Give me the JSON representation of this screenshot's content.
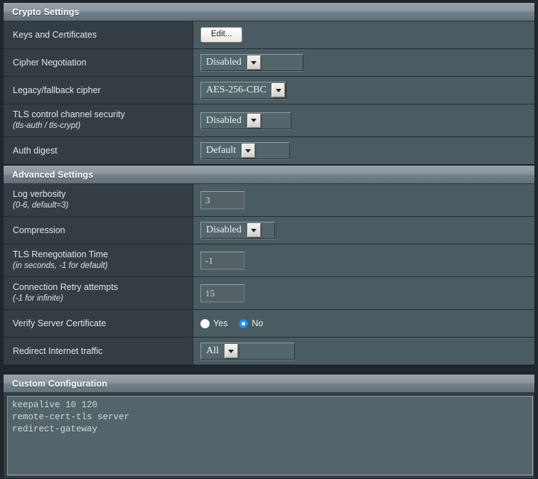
{
  "sections": [
    {
      "id": "crypto",
      "title": "Crypto Settings",
      "rows": [
        {
          "label": "Keys and Certificates",
          "sub": "",
          "control": "button",
          "value": "Edit...",
          "width": 0
        },
        {
          "label": "Cipher Negotiation",
          "sub": "",
          "control": "select",
          "value": "Disabled",
          "width": 145
        },
        {
          "label": "Legacy/fallback cipher",
          "sub": "",
          "control": "select",
          "value": "AES-256-CBC",
          "width": 121
        },
        {
          "label": "TLS control channel security",
          "sub": "(tls-auth / tls-crypt)",
          "control": "select",
          "value": "Disabled",
          "width": 128
        },
        {
          "label": "Auth digest",
          "sub": "",
          "control": "select",
          "value": "Default",
          "width": 126
        }
      ]
    },
    {
      "id": "advanced",
      "title": "Advanced Settings",
      "rows": [
        {
          "label": "Log verbosity",
          "sub": "(0-6, default=3)",
          "control": "text",
          "value": "3",
          "width": 62
        },
        {
          "label": "Compression",
          "sub": "",
          "control": "select",
          "value": "Disabled",
          "width": 105
        },
        {
          "label": "TLS Renegotiation Time",
          "sub": "(in seconds, -1 for default)",
          "control": "text",
          "value": "-1",
          "width": 62
        },
        {
          "label": "Connection Retry attempts",
          "sub": "(-1 for infinite)",
          "control": "text",
          "value": "15",
          "width": 62
        },
        {
          "label": "Verify Server Certificate",
          "sub": "",
          "control": "radio",
          "options": [
            {
              "label": "Yes",
              "selected": false
            },
            {
              "label": "No",
              "selected": true
            }
          ]
        },
        {
          "label": "Redirect Internet traffic",
          "sub": "",
          "control": "select",
          "value": "All",
          "width": 133
        }
      ]
    }
  ],
  "custom_config": {
    "title": "Custom Configuration",
    "text": "keepalive 10 120\nremote-cert-tls server\nredirect-gateway"
  },
  "colors": {
    "page_bg": "#20282d",
    "row_bg": "#343d44",
    "field_bg": "#4a5b61",
    "header_top": "#98a3aa",
    "header_bottom": "#63707a",
    "accent_radio": "#1e90ff",
    "text": "#e2e6e8"
  }
}
